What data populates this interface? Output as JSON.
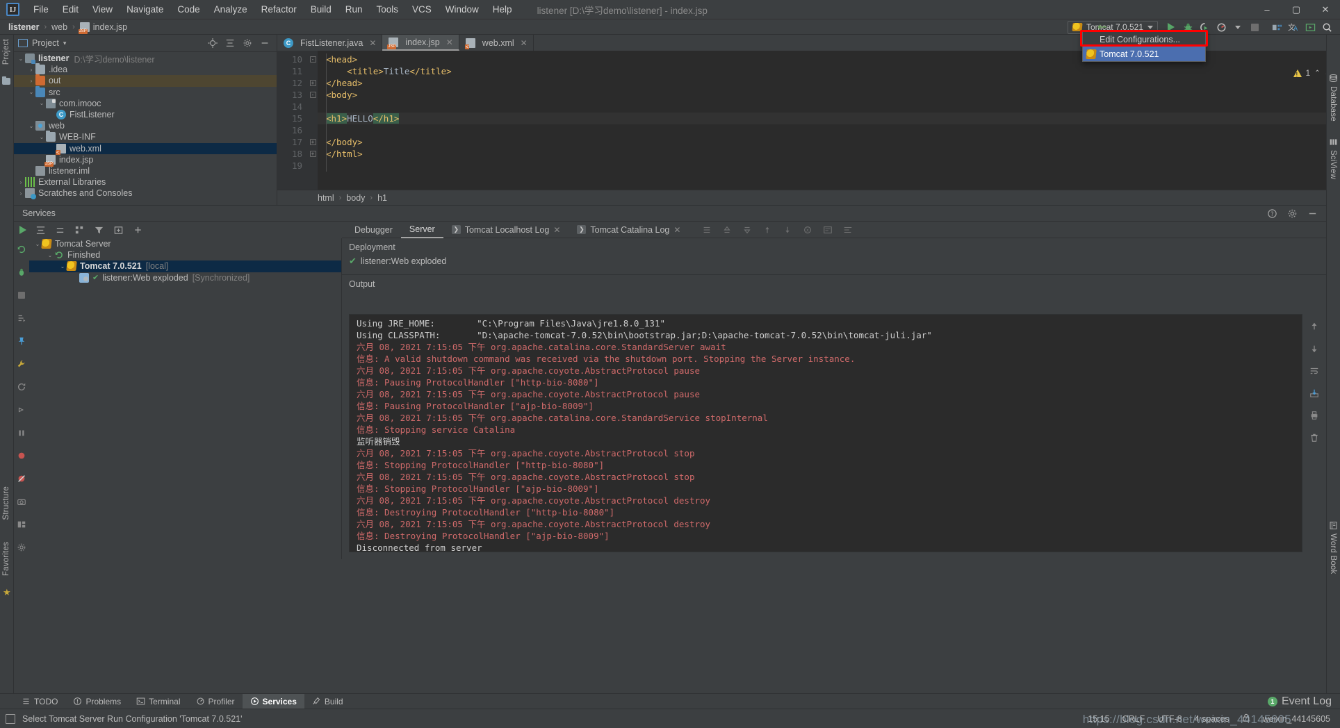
{
  "window": {
    "title": "listener [D:\\学习demo\\listener] - index.jsp",
    "logo": "IJ",
    "minimize": "–",
    "maximize": "▢",
    "close": "✕"
  },
  "menu": [
    {
      "label": "File"
    },
    {
      "label": "Edit"
    },
    {
      "label": "View"
    },
    {
      "label": "Navigate"
    },
    {
      "label": "Code"
    },
    {
      "label": "Analyze"
    },
    {
      "label": "Refactor"
    },
    {
      "label": "Build"
    },
    {
      "label": "Run"
    },
    {
      "label": "Tools"
    },
    {
      "label": "VCS"
    },
    {
      "label": "Window"
    },
    {
      "label": "Help"
    }
  ],
  "breadcrumb": {
    "items": [
      {
        "label": "listener",
        "bold": true
      },
      {
        "label": "web",
        "bold": false
      },
      {
        "label": "index.jsp",
        "bold": false
      }
    ],
    "separator": "›"
  },
  "run_toolbar": {
    "config_name": "Tomcat 7.0.521",
    "config_icon": "tomcat-icon",
    "run_label": "Run",
    "debug_label": "Debug",
    "coverage_label": "Run with Coverage",
    "profile_label": "Profile",
    "stop_label": "Stop",
    "dropdown_caret": "▾"
  },
  "run_dropdown": {
    "items": [
      {
        "label": "Edit Configurations...",
        "selected": false,
        "icon": null,
        "highlighted": true
      },
      {
        "label": "Tomcat 7.0.521",
        "selected": true,
        "icon": "tomcat-icon",
        "highlighted": false
      }
    ],
    "highlight_color": "#ff0000"
  },
  "project_panel": {
    "tool_label": "Project",
    "title": "Project",
    "caret": "▾",
    "icons": [
      "locate-icon",
      "collapse-all-icon",
      "settings-icon",
      "hide-icon"
    ],
    "tree": [
      {
        "depth": 0,
        "arrow": "⌄",
        "icon": "module-icon",
        "label": "listener",
        "bold": true,
        "path": "D:\\学习demo\\listener",
        "state": "normal"
      },
      {
        "depth": 1,
        "arrow": "›",
        "icon": "folder-gray-icon",
        "label": ".idea",
        "bold": false,
        "path": "",
        "state": "normal"
      },
      {
        "depth": 1,
        "arrow": "›",
        "icon": "folder-orange-icon",
        "label": "out",
        "bold": false,
        "path": "",
        "state": "amber"
      },
      {
        "depth": 1,
        "arrow": "⌄",
        "icon": "folder-blue-icon",
        "label": "src",
        "bold": false,
        "path": "",
        "state": "normal"
      },
      {
        "depth": 2,
        "arrow": "⌄",
        "icon": "package-icon",
        "label": "com.imooc",
        "bold": false,
        "path": "",
        "state": "normal"
      },
      {
        "depth": 3,
        "arrow": "",
        "icon": "class-icon",
        "label": "FistListener",
        "bold": false,
        "path": "",
        "state": "normal"
      },
      {
        "depth": 1,
        "arrow": "⌄",
        "icon": "webroot-icon",
        "label": "web",
        "bold": false,
        "path": "",
        "state": "normal"
      },
      {
        "depth": 2,
        "arrow": "⌄",
        "icon": "folder-gray-icon",
        "label": "WEB-INF",
        "bold": false,
        "path": "",
        "state": "normal"
      },
      {
        "depth": 3,
        "arrow": "",
        "icon": "xml-file-icon",
        "label": "web.xml",
        "bold": false,
        "path": "",
        "state": "selected"
      },
      {
        "depth": 2,
        "arrow": "",
        "icon": "jsp-file-icon",
        "label": "index.jsp",
        "bold": false,
        "path": "",
        "state": "normal"
      },
      {
        "depth": 1,
        "arrow": "",
        "icon": "iml-file-icon",
        "label": "listener.iml",
        "bold": false,
        "path": "",
        "state": "normal"
      },
      {
        "depth": 0,
        "arrow": "›",
        "icon": "library-icon",
        "label": "External Libraries",
        "bold": false,
        "path": "",
        "state": "normal"
      },
      {
        "depth": 0,
        "arrow": "›",
        "icon": "scratch-icon",
        "label": "Scratches and Consoles",
        "bold": false,
        "path": "",
        "state": "normal"
      }
    ]
  },
  "editor": {
    "tabs": [
      {
        "label": "FistListener.java",
        "icon": "class-icon",
        "active": false,
        "close": "✕"
      },
      {
        "label": "index.jsp",
        "icon": "jsp-file-icon",
        "active": true,
        "close": "✕"
      },
      {
        "label": "web.xml",
        "icon": "xml-file-icon",
        "active": false,
        "close": "✕"
      }
    ],
    "first_line_number": 10,
    "lines": [
      {
        "num": 10,
        "fold": "-",
        "text": "<head>",
        "highlight": false
      },
      {
        "num": 11,
        "fold": "",
        "text": "    <title>Title</title>",
        "highlight": false
      },
      {
        "num": 12,
        "fold": "+",
        "text": "</head>",
        "highlight": false
      },
      {
        "num": 13,
        "fold": "-",
        "text": "<body>",
        "highlight": false
      },
      {
        "num": 14,
        "fold": "",
        "text": "",
        "highlight": false
      },
      {
        "num": 15,
        "fold": "",
        "text": "<h1>HELLO</h1>",
        "highlight": true
      },
      {
        "num": 16,
        "fold": "",
        "text": "",
        "highlight": false
      },
      {
        "num": 17,
        "fold": "+",
        "text": "</body>",
        "highlight": false
      },
      {
        "num": 18,
        "fold": "+",
        "text": "</html>",
        "highlight": false
      },
      {
        "num": 19,
        "fold": "",
        "text": "",
        "highlight": false
      }
    ],
    "structure_breadcrumb": [
      "html",
      "body",
      "h1"
    ],
    "breadcrumb_separator": "›",
    "warning_count": "1",
    "nav_up": "⌃",
    "nav_down": "⌄"
  },
  "services": {
    "panel_title": "Services",
    "toolbar_icons": [
      "run-icon",
      "expand-all-icon",
      "collapse-all-icon",
      "group-icon",
      "filter-icon",
      "add-tab-icon",
      "add-icon"
    ],
    "head_icons": [
      "help-icon",
      "settings-icon",
      "hide-icon"
    ],
    "tree": [
      {
        "depth": 0,
        "arrow": "⌄",
        "icon": "tomcat-icon",
        "label": "Tomcat Server",
        "bold": false,
        "suffix": "",
        "state": "normal"
      },
      {
        "depth": 1,
        "arrow": "⌄",
        "icon": "rerun-icon",
        "label": "Finished",
        "bold": false,
        "suffix": "",
        "state": "normal"
      },
      {
        "depth": 2,
        "arrow": "⌄",
        "icon": "tomcat-icon",
        "label": "Tomcat 7.0.521",
        "bold": true,
        "suffix": "[local]",
        "state": "selected"
      },
      {
        "depth": 3,
        "arrow": "",
        "icon": "artifact-icon",
        "label": "listener:Web exploded",
        "bold": false,
        "suffix": "[Synchronized]",
        "state": "normal"
      }
    ],
    "rail_icons": [
      "rerun-icon",
      "debug-icon",
      "stop-icon",
      "thread-dump-icon",
      "pin-icon",
      "wrench-icon",
      "refresh-icon",
      "step-icon",
      "pause-icon",
      "breakpoint-icon",
      "mute-icon",
      "camera-icon",
      "layout-icon",
      "settings-icon"
    ]
  },
  "console": {
    "tabs": [
      {
        "label": "Debugger",
        "icon": null,
        "active": false,
        "closable": false
      },
      {
        "label": "Server",
        "icon": null,
        "active": true,
        "closable": false
      },
      {
        "label": "Tomcat Localhost Log",
        "icon": "console-icon",
        "active": false,
        "closable": true
      },
      {
        "label": "Tomcat Catalina Log",
        "icon": "console-icon",
        "active": false,
        "closable": true
      }
    ],
    "close_glyph": "✕",
    "toolbar_icons": [
      "align-icon",
      "up-stack-icon",
      "down-stack-icon",
      "force-step-icon",
      "step-out-icon",
      "evaluate-icon",
      "wrap-icon",
      "soft-wrap-icon"
    ],
    "deployment_label": "Deployment",
    "deployment_items": [
      {
        "label": "listener:Web exploded",
        "status_icon": "check-icon"
      }
    ],
    "output_label": "Output",
    "output_lines": [
      {
        "text": "Using JRE_HOME:        \"C:\\Program Files\\Java\\jre1.8.0_131\"",
        "color": "normal"
      },
      {
        "text": "Using CLASSPATH:       \"D:\\apache-tomcat-7.0.52\\bin\\bootstrap.jar;D:\\apache-tomcat-7.0.52\\bin\\tomcat-juli.jar\"",
        "color": "normal"
      },
      {
        "text": "六月 08, 2021 7:15:05 下午 org.apache.catalina.core.StandardServer await",
        "color": "red"
      },
      {
        "text": "信息: A valid shutdown command was received via the shutdown port. Stopping the Server instance.",
        "color": "red"
      },
      {
        "text": "六月 08, 2021 7:15:05 下午 org.apache.coyote.AbstractProtocol pause",
        "color": "red"
      },
      {
        "text": "信息: Pausing ProtocolHandler [\"http-bio-8080\"]",
        "color": "red"
      },
      {
        "text": "六月 08, 2021 7:15:05 下午 org.apache.coyote.AbstractProtocol pause",
        "color": "red"
      },
      {
        "text": "信息: Pausing ProtocolHandler [\"ajp-bio-8009\"]",
        "color": "red"
      },
      {
        "text": "六月 08, 2021 7:15:05 下午 org.apache.catalina.core.StandardService stopInternal",
        "color": "red"
      },
      {
        "text": "信息: Stopping service Catalina",
        "color": "red"
      },
      {
        "text": "监听器销毁",
        "color": "normal"
      },
      {
        "text": "六月 08, 2021 7:15:05 下午 org.apache.coyote.AbstractProtocol stop",
        "color": "red"
      },
      {
        "text": "信息: Stopping ProtocolHandler [\"http-bio-8080\"]",
        "color": "red"
      },
      {
        "text": "六月 08, 2021 7:15:05 下午 org.apache.coyote.AbstractProtocol stop",
        "color": "red"
      },
      {
        "text": "信息: Stopping ProtocolHandler [\"ajp-bio-8009\"]",
        "color": "red"
      },
      {
        "text": "六月 08, 2021 7:15:05 下午 org.apache.coyote.AbstractProtocol destroy",
        "color": "red"
      },
      {
        "text": "信息: Destroying ProtocolHandler [\"http-bio-8080\"]",
        "color": "red"
      },
      {
        "text": "六月 08, 2021 7:15:05 下午 org.apache.coyote.AbstractProtocol destroy",
        "color": "red"
      },
      {
        "text": "信息: Destroying ProtocolHandler [\"ajp-bio-8009\"]",
        "color": "red"
      },
      {
        "text": "Disconnected from server",
        "color": "normal"
      }
    ]
  },
  "right_strip": {
    "labels": [
      "Database",
      "SciView",
      "Word Book"
    ]
  },
  "left_strip": {
    "labels": [
      "Project"
    ]
  },
  "bottom_left_strip": {
    "labels": [
      "Structure",
      "Favorites"
    ]
  },
  "tool_window_bar": {
    "items": [
      {
        "label": "TODO",
        "icon": "todo-icon",
        "active": false
      },
      {
        "label": "Problems",
        "icon": "problems-icon",
        "active": false
      },
      {
        "label": "Terminal",
        "icon": "terminal-icon",
        "active": false
      },
      {
        "label": "Profiler",
        "icon": "profiler-icon",
        "active": false
      },
      {
        "label": "Services",
        "icon": "services-icon",
        "active": true
      },
      {
        "label": "Build",
        "icon": "build-icon",
        "active": false
      }
    ],
    "event_log": {
      "label": "Event Log",
      "count": "1"
    }
  },
  "status_bar": {
    "message": "Select Tomcat Server Run Configuration 'Tomcat 7.0.521'",
    "icon": "notification-icon",
    "position": "15:15",
    "line_separator": "CRLF",
    "encoding": "UTF-8",
    "indent": "4 spaces",
    "lock_icon": "lock-icon",
    "branch": "weixin_44145605"
  },
  "watermark": {
    "text": "https://blog.csdn.net/weixin_44145605"
  }
}
